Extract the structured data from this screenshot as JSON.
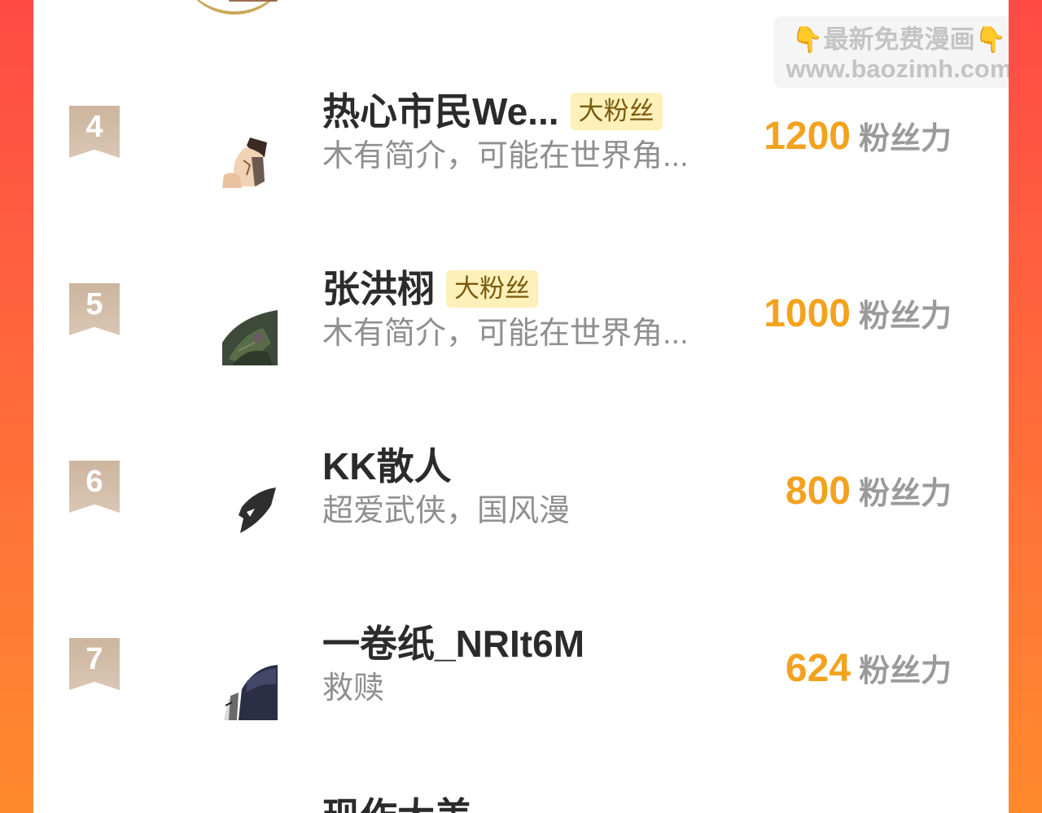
{
  "watermark": {
    "line1_emoji_left": "👇",
    "line1_text": "最新免费漫画",
    "line1_emoji_right": "👇",
    "line2": "www.baozimh.com"
  },
  "rows": [
    {
      "rank": "4",
      "name": "热心市民We...",
      "badge": "大粉丝",
      "bio": "木有简介，可能在世界角...",
      "fans_value": "1200",
      "fans_unit": "粉丝力"
    },
    {
      "rank": "5",
      "name": "张洪栩",
      "badge": "大粉丝",
      "bio": "木有简介，可能在世界角...",
      "fans_value": "1000",
      "fans_unit": "粉丝力"
    },
    {
      "rank": "6",
      "name": "KK散人",
      "badge": "",
      "bio": "超爱武侠，国风漫",
      "fans_value": "800",
      "fans_unit": "粉丝力"
    },
    {
      "rank": "7",
      "name": "一卷纸_NRIt6M",
      "badge": "",
      "bio": "救赎",
      "fans_value": "624",
      "fans_unit": "粉丝力"
    }
  ],
  "next_row": {
    "name_partial": "现作大美"
  },
  "colors": {
    "background_gradient_top": "#ff4a45",
    "background_gradient_bottom": "#ff8a2e",
    "fans_value": "#f3a21f",
    "badge_bg": "#fdf0b8",
    "rank_ribbon": "#d4bda8"
  }
}
